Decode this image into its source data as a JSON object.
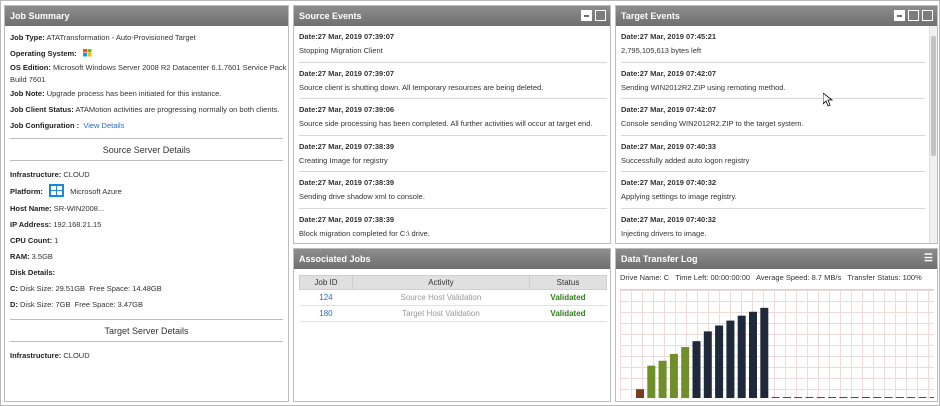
{
  "job_summary": {
    "title": "Job Summary",
    "job_type_label": "Job Type:",
    "job_type": "ATATransformation - Auto-Provisioned Target",
    "os_label": "Operating System:",
    "os_edition_label": "OS Edition:",
    "os_edition_1": "Microsoft Windows Server 2008 R2 Datacenter 6.1.7601 Service Pack 1",
    "os_edition_2": "Build 7601",
    "job_note_label": "Job Note:",
    "job_note": "Upgrade process has been initiated for this instance.",
    "client_status_label": "Job Client Status:",
    "client_status": "ATAMotion activities are progressing normally on both clients.",
    "config_label": "Job Configuration :",
    "config_link": "View Details",
    "source_section": "Source Server Details",
    "infra_label": "Infrastructure:",
    "infra": "CLOUD",
    "platform_label": "Platform:",
    "platform": "Microsoft Azure",
    "host_label": "Host Name:",
    "host": "SR-WIN2008...",
    "ip_label": "IP Address:",
    "ip": "192.168.21.15",
    "cpu_label": "CPU Count:",
    "cpu": "1",
    "ram_label": "RAM:",
    "ram": "3.5GB",
    "disk_label": "Disk Details:",
    "disk_c_drive": "C:",
    "disk_c_size": "Disk Size: 29.51GB",
    "disk_c_free": "Free Space: 14.48GB",
    "disk_d_drive": "D:",
    "disk_d_size": "Disk Size: 7GB",
    "disk_d_free": "Free Space: 3.47GB",
    "target_section": "Target Server Details",
    "target_infra_label": "Infrastructure:",
    "target_infra": "CLOUD"
  },
  "source_events": {
    "title": "Source Events",
    "items": [
      {
        "date": "Date:27 Mar, 2019 07:39:07",
        "msg": "Stopping Migration Client"
      },
      {
        "date": "Date:27 Mar, 2019 07:39:07",
        "msg": "Source client is shutting down. All temporary resources are being deleted."
      },
      {
        "date": "Date:27 Mar, 2019 07:39:06",
        "msg": "Source side processing has been completed. All further activities will occur at target end."
      },
      {
        "date": "Date:27 Mar, 2019 07:38:39",
        "msg": "Creating Image for registry"
      },
      {
        "date": "Date:27 Mar, 2019 07:38:39",
        "msg": "Sending drive shadow xml to console."
      },
      {
        "date": "Date:27 Mar, 2019 07:38:39",
        "msg": "Block migration completed for C:\\ drive."
      }
    ]
  },
  "target_events": {
    "title": "Target Events",
    "items": [
      {
        "date": "Date:27 Mar, 2019 07:45:21",
        "msg": "2,795,105,613 bytes left"
      },
      {
        "date": "Date:27 Mar, 2019 07:42:07",
        "msg": "Sending WIN2012R2.ZIP using remoting method."
      },
      {
        "date": "Date:27 Mar, 2019 07:42:07",
        "msg": "Console sending WIN2012R2.ZIP to the target system."
      },
      {
        "date": "Date:27 Mar, 2019 07:40:33",
        "msg": "Successfully added auto logon registry"
      },
      {
        "date": "Date:27 Mar, 2019 07:40:32",
        "msg": "Applying settings to image registry."
      },
      {
        "date": "Date:27 Mar, 2019 07:40:32",
        "msg": "Injecting drivers to image."
      }
    ]
  },
  "associated_jobs": {
    "title": "Associated Jobs",
    "headers": [
      "Job ID",
      "Activity",
      "Status"
    ],
    "rows": [
      {
        "id": "124",
        "activity": "Source Host Validation",
        "status": "Validated"
      },
      {
        "id": "180",
        "activity": "Target Host Validation",
        "status": "Validated"
      }
    ]
  },
  "transfer_log": {
    "title": "Data Transfer Log",
    "drive_name": "Drive Name:  C",
    "time_left": "Time Left:  00:00:00:00",
    "avg_speed": "Average Speed:  8.7 MB/s",
    "transfer_status": "Transfer Status:  100%"
  },
  "chart_data": {
    "type": "bar",
    "title": "",
    "xlabel": "",
    "ylabel": "",
    "values": [
      0.09,
      0.33,
      0.38,
      0.45,
      0.52,
      0.58,
      0.68,
      0.74,
      0.79,
      0.84,
      0.88,
      0.92,
      0.004,
      0.004,
      0.004,
      0.004,
      0.004,
      0.004,
      0.004,
      0.004,
      0.004,
      0.004,
      0.004,
      0.004,
      0.004,
      0.004,
      0.004,
      0.03,
      0.03,
      0.03
    ],
    "colors": [
      "#7a3b1e",
      "#6f8f2a",
      "#6f8f2a",
      "#6f8f2a",
      "#6f8f2a",
      "#1e2a3a",
      "#1e2a3a",
      "#1e2a3a",
      "#1e2a3a",
      "#1e2a3a",
      "#1e2a3a",
      "#1e2a3a",
      "#6a3a6a",
      "#6a3a6a",
      "#6a3a6a",
      "#6a3a6a",
      "#6a3a6a",
      "#6a3a6a",
      "#6a3a6a",
      "#6a3a6a",
      "#6a3a6a",
      "#6a3a6a",
      "#6a3a6a",
      "#6a3a6a",
      "#6a3a6a",
      "#6a3a6a",
      "#6a3a6a",
      "#6a3a6a",
      "#6a3a6a",
      "#6a3a6a"
    ],
    "ylim": [
      0,
      1
    ],
    "grid": true
  }
}
